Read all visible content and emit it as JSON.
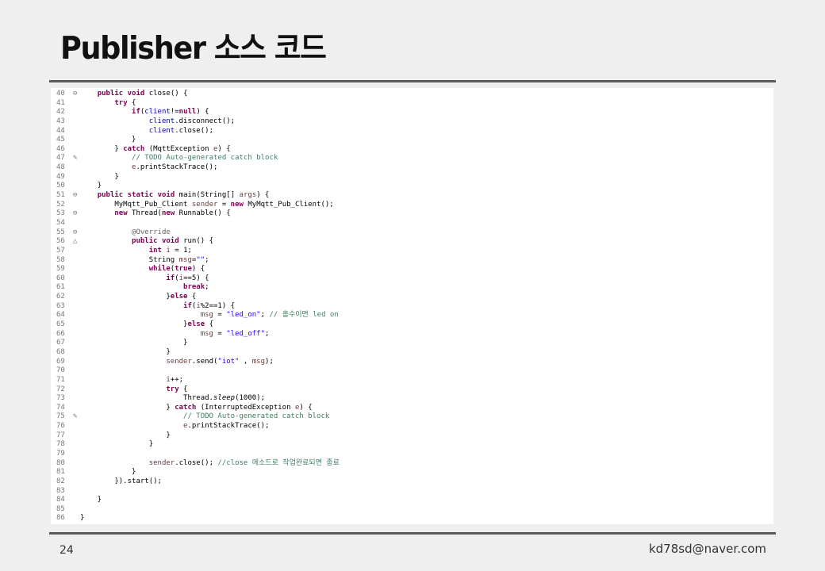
{
  "slide": {
    "title": "Publisher 소스 코드",
    "page_number": "24",
    "email": "kd78sd@naver.com"
  },
  "code_lines": [
    {
      "num": "40",
      "marker": "⊖",
      "tokens": [
        {
          "t": "    "
        },
        {
          "t": "public",
          "c": "kw"
        },
        {
          "t": " "
        },
        {
          "t": "void",
          "c": "kw"
        },
        {
          "t": " close() {"
        }
      ]
    },
    {
      "num": "41",
      "tokens": [
        {
          "t": "        "
        },
        {
          "t": "try",
          "c": "kw"
        },
        {
          "t": " {"
        }
      ]
    },
    {
      "num": "42",
      "tokens": [
        {
          "t": "            "
        },
        {
          "t": "if",
          "c": "kw"
        },
        {
          "t": "("
        },
        {
          "t": "client",
          "c": "fld"
        },
        {
          "t": "!="
        },
        {
          "t": "null",
          "c": "kw"
        },
        {
          "t": ") {"
        }
      ]
    },
    {
      "num": "43",
      "tokens": [
        {
          "t": "                "
        },
        {
          "t": "client",
          "c": "fld"
        },
        {
          "t": ".disconnect();"
        }
      ]
    },
    {
      "num": "44",
      "tokens": [
        {
          "t": "                "
        },
        {
          "t": "client",
          "c": "fld"
        },
        {
          "t": ".close();"
        }
      ]
    },
    {
      "num": "45",
      "tokens": [
        {
          "t": "            }"
        }
      ]
    },
    {
      "num": "46",
      "tokens": [
        {
          "t": "        } "
        },
        {
          "t": "catch",
          "c": "kw"
        },
        {
          "t": " (MqttException "
        },
        {
          "t": "e",
          "c": "var"
        },
        {
          "t": ") {"
        }
      ]
    },
    {
      "num": "47",
      "marker": "✎",
      "tokens": [
        {
          "t": "            "
        },
        {
          "t": "// ",
          "c": "cm"
        },
        {
          "t": "TODO",
          "c": "cm"
        },
        {
          "t": " Auto-generated catch block",
          "c": "cm"
        }
      ]
    },
    {
      "num": "48",
      "tokens": [
        {
          "t": "            "
        },
        {
          "t": "e",
          "c": "var"
        },
        {
          "t": ".printStackTrace();"
        }
      ]
    },
    {
      "num": "49",
      "tokens": [
        {
          "t": "        }"
        }
      ]
    },
    {
      "num": "50",
      "tokens": [
        {
          "t": "    }"
        }
      ]
    },
    {
      "num": "51",
      "marker": "⊖",
      "tokens": [
        {
          "t": "    "
        },
        {
          "t": "public",
          "c": "kw"
        },
        {
          "t": " "
        },
        {
          "t": "static",
          "c": "kw"
        },
        {
          "t": " "
        },
        {
          "t": "void",
          "c": "kw"
        },
        {
          "t": " main(String[] "
        },
        {
          "t": "args",
          "c": "var"
        },
        {
          "t": ") {"
        }
      ]
    },
    {
      "num": "52",
      "tokens": [
        {
          "t": "        MyMqtt_Pub_Client "
        },
        {
          "t": "sender",
          "c": "var"
        },
        {
          "t": " = "
        },
        {
          "t": "new",
          "c": "kw"
        },
        {
          "t": " MyMqtt_Pub_Client();"
        }
      ]
    },
    {
      "num": "53",
      "marker": "⊖",
      "tokens": [
        {
          "t": "        "
        },
        {
          "t": "new",
          "c": "kw"
        },
        {
          "t": " Thread("
        },
        {
          "t": "new",
          "c": "kw"
        },
        {
          "t": " Runnable() {"
        }
      ]
    },
    {
      "num": "54",
      "tokens": [
        {
          "t": ""
        }
      ]
    },
    {
      "num": "55",
      "marker": "⊖",
      "tokens": [
        {
          "t": "            "
        },
        {
          "t": "@Override",
          "c": "ann"
        }
      ]
    },
    {
      "num": "56",
      "marker": "△",
      "tokens": [
        {
          "t": "            "
        },
        {
          "t": "public",
          "c": "kw"
        },
        {
          "t": " "
        },
        {
          "t": "void",
          "c": "kw"
        },
        {
          "t": " run() {"
        }
      ]
    },
    {
      "num": "57",
      "tokens": [
        {
          "t": "                "
        },
        {
          "t": "int",
          "c": "kw"
        },
        {
          "t": " "
        },
        {
          "t": "i",
          "c": "var"
        },
        {
          "t": " = 1;"
        }
      ]
    },
    {
      "num": "58",
      "tokens": [
        {
          "t": "                String "
        },
        {
          "t": "msg",
          "c": "var"
        },
        {
          "t": "="
        },
        {
          "t": "\"\"",
          "c": "str"
        },
        {
          "t": ";"
        }
      ]
    },
    {
      "num": "59",
      "tokens": [
        {
          "t": "                "
        },
        {
          "t": "while",
          "c": "kw"
        },
        {
          "t": "("
        },
        {
          "t": "true",
          "c": "kw"
        },
        {
          "t": ") {"
        }
      ]
    },
    {
      "num": "60",
      "tokens": [
        {
          "t": "                    "
        },
        {
          "t": "if",
          "c": "kw"
        },
        {
          "t": "("
        },
        {
          "t": "i",
          "c": "var"
        },
        {
          "t": "==5) {"
        }
      ]
    },
    {
      "num": "61",
      "tokens": [
        {
          "t": "                        "
        },
        {
          "t": "break",
          "c": "kw"
        },
        {
          "t": ";"
        }
      ]
    },
    {
      "num": "62",
      "tokens": [
        {
          "t": "                    }"
        },
        {
          "t": "else",
          "c": "kw"
        },
        {
          "t": " {"
        }
      ]
    },
    {
      "num": "63",
      "tokens": [
        {
          "t": "                        "
        },
        {
          "t": "if",
          "c": "kw"
        },
        {
          "t": "("
        },
        {
          "t": "i",
          "c": "var"
        },
        {
          "t": "%2==1) {"
        }
      ]
    },
    {
      "num": "64",
      "tokens": [
        {
          "t": "                            "
        },
        {
          "t": "msg",
          "c": "var"
        },
        {
          "t": " = "
        },
        {
          "t": "\"led_on\"",
          "c": "str"
        },
        {
          "t": "; "
        },
        {
          "t": "// 홀수이면 led on",
          "c": "cm"
        }
      ]
    },
    {
      "num": "65",
      "tokens": [
        {
          "t": "                        }"
        },
        {
          "t": "else",
          "c": "kw"
        },
        {
          "t": " {"
        }
      ]
    },
    {
      "num": "66",
      "tokens": [
        {
          "t": "                            "
        },
        {
          "t": "msg",
          "c": "var"
        },
        {
          "t": " = "
        },
        {
          "t": "\"led_off\"",
          "c": "str"
        },
        {
          "t": ";"
        }
      ]
    },
    {
      "num": "67",
      "tokens": [
        {
          "t": "                        }"
        }
      ]
    },
    {
      "num": "68",
      "tokens": [
        {
          "t": "                    }"
        }
      ]
    },
    {
      "num": "69",
      "tokens": [
        {
          "t": "                    "
        },
        {
          "t": "sender",
          "c": "var"
        },
        {
          "t": ".send("
        },
        {
          "t": "\"iot\"",
          "c": "str"
        },
        {
          "t": " , "
        },
        {
          "t": "msg",
          "c": "var"
        },
        {
          "t": ");"
        }
      ]
    },
    {
      "num": "70",
      "tokens": [
        {
          "t": ""
        }
      ]
    },
    {
      "num": "71",
      "tokens": [
        {
          "t": "                    "
        },
        {
          "t": "i",
          "c": "var"
        },
        {
          "t": "++;"
        }
      ]
    },
    {
      "num": "72",
      "tokens": [
        {
          "t": "                    "
        },
        {
          "t": "try",
          "c": "kw"
        },
        {
          "t": " {"
        }
      ]
    },
    {
      "num": "73",
      "tokens": [
        {
          "t": "                        Thread."
        },
        {
          "t": "sleep",
          "c": "it"
        },
        {
          "t": "(1000);"
        }
      ]
    },
    {
      "num": "74",
      "tokens": [
        {
          "t": "                    } "
        },
        {
          "t": "catch",
          "c": "kw"
        },
        {
          "t": " (InterruptedException "
        },
        {
          "t": "e",
          "c": "var"
        },
        {
          "t": ") {"
        }
      ]
    },
    {
      "num": "75",
      "marker": "✎",
      "tokens": [
        {
          "t": "                        "
        },
        {
          "t": "// TODO Auto-generated catch block",
          "c": "cm"
        }
      ]
    },
    {
      "num": "76",
      "tokens": [
        {
          "t": "                        "
        },
        {
          "t": "e",
          "c": "var"
        },
        {
          "t": ".printStackTrace();"
        }
      ]
    },
    {
      "num": "77",
      "tokens": [
        {
          "t": "                    }"
        }
      ]
    },
    {
      "num": "78",
      "tokens": [
        {
          "t": "                }"
        }
      ]
    },
    {
      "num": "79",
      "tokens": [
        {
          "t": ""
        }
      ]
    },
    {
      "num": "80",
      "tokens": [
        {
          "t": "                "
        },
        {
          "t": "sender",
          "c": "var"
        },
        {
          "t": ".close(); "
        },
        {
          "t": "//close 메소드로 작업완료되면 종료",
          "c": "cm"
        }
      ]
    },
    {
      "num": "81",
      "tokens": [
        {
          "t": "            }"
        }
      ]
    },
    {
      "num": "82",
      "tokens": [
        {
          "t": "        }).start();"
        }
      ]
    },
    {
      "num": "83",
      "tokens": [
        {
          "t": ""
        }
      ]
    },
    {
      "num": "84",
      "tokens": [
        {
          "t": "    }"
        }
      ]
    },
    {
      "num": "85",
      "tokens": [
        {
          "t": ""
        }
      ]
    },
    {
      "num": "86",
      "tokens": [
        {
          "t": "}"
        }
      ]
    }
  ]
}
